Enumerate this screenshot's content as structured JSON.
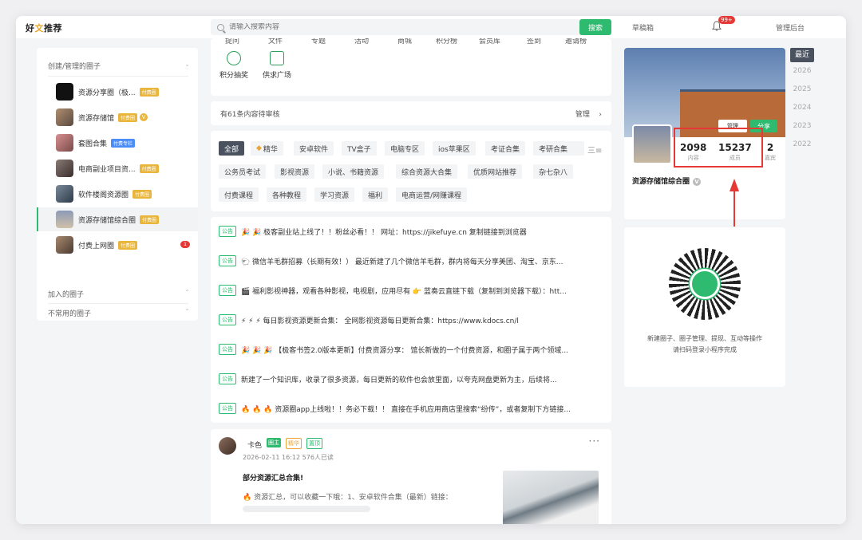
{
  "header": {
    "logo_main": "好",
    "logo_accent": "文",
    "logo_rest": "推荐",
    "search_placeholder": "请输入搜索内容",
    "search_button": "搜索",
    "drafts": "草稿箱",
    "notification_count": "99+",
    "admin": "管理后台"
  },
  "sidebar": {
    "section_created": "创建/管理的圈子",
    "section_joined": "加入的圈子",
    "section_unused": "不常用的圈子",
    "items": [
      {
        "name": "资源分享圈（极...",
        "tag": "付费圈",
        "tag_type": "paid",
        "thumb": "#111111"
      },
      {
        "name": "资源存储馆",
        "tag": "付费圈",
        "tag_type": "paid",
        "thumb": "#8e7a68",
        "verified": "V"
      },
      {
        "name": "套图合集",
        "tag": "付费专栏",
        "tag_type": "blue",
        "thumb": "#c47a7a"
      },
      {
        "name": "电商副业项目资...",
        "tag": "付费圈",
        "tag_type": "paid",
        "thumb": "#6a5a58"
      },
      {
        "name": "软件楼阁资源圈",
        "tag": "付费圈",
        "tag_type": "paid",
        "thumb": "#556677"
      },
      {
        "name": "资源存储馆综合圈",
        "tag": "付费圈",
        "tag_type": "paid",
        "thumb": "#9aa3b8",
        "active": true
      },
      {
        "name": "付费上网圈",
        "tag": "付费圈",
        "tag_type": "paid",
        "thumb": "#8a7060",
        "count": "1"
      }
    ]
  },
  "nav": {
    "top_row": [
      "提问",
      "文件",
      "专题",
      "活动",
      "商城",
      "积分榜",
      "会员库",
      "签到",
      "邀请榜"
    ],
    "icons": [
      {
        "label": "积分抽奖"
      },
      {
        "label": "供求广场"
      }
    ]
  },
  "review": {
    "text": "有61条内容待审核",
    "manage": "管理",
    "chevron": "›"
  },
  "categories": {
    "row1": [
      "全部",
      "精华",
      "安卓软件",
      "TV盒子",
      "电脑专区",
      "ios苹果区",
      "考证合集",
      "考研合集"
    ],
    "row1_more": "三≡",
    "row2": [
      "公务员考试",
      "影视资源",
      "小说、书籍资源",
      "综合资源大合集",
      "优质网站推荐",
      "杂七杂八"
    ],
    "row3": [
      "付费课程",
      "各种教程",
      "学习资源",
      "福利",
      "电商运营/网赚课程"
    ]
  },
  "announcements": [
    {
      "tag": "公告",
      "text": "🎉 🎉 极客副业站上线了！！粉丝必看！！ 网址：https://jikefuye.cn 复制链接到浏览器"
    },
    {
      "tag": "公告",
      "text": "🐑 微信羊毛群招募（长期有效！） 最近新建了几个微信羊毛群，群内将每天分享美团、淘宝、京东..."
    },
    {
      "tag": "公告",
      "text": "🎬 福利影视神器，观看各种影视，电视剧，应用尽有 👉 蓝奏云直链下载（复制到浏览器下载）：htt..."
    },
    {
      "tag": "公告",
      "text": "⚡ ⚡ ⚡ 每日影视资源更新合集： 全网影视资源每日更新合集：https://www.kdocs.cn/l"
    },
    {
      "tag": "公告",
      "text": "🎉 🎉 🎉 【极客书签2.0版本更新】付费资源分享： 馆长新做的一个付费资源，和圈子属于两个领域..."
    },
    {
      "tag": "公告",
      "text": "新建了一个知识库，收录了很多资源，每日更新的软件也会放里面，以夸克网盘更新为主，后续将..."
    },
    {
      "tag": "公告",
      "text": "🔥 🔥 🔥 资源圈app上线啦！！务必下载！！ 直接在手机应用商店里搜索“纷传”，或者复制下方链接..."
    }
  ],
  "post": {
    "author": "卡色",
    "tags": [
      "圈主",
      "精华",
      "置顶"
    ],
    "meta": "2026-02-11 16:12   576人已读",
    "more": "···",
    "title": "部分资源汇总合集!",
    "body": "🔥 资源汇总，可以收藏一下哦：1、安卓软件合集（最新）链接："
  },
  "group": {
    "btn_manage": "管理",
    "btn_share": "分享",
    "stats": [
      {
        "value": "2098",
        "label": "内容"
      },
      {
        "value": "15237",
        "label": "成员"
      },
      {
        "value": "2",
        "label": "嘉宾"
      }
    ],
    "name": "资源存储馆综合圈",
    "verified": "V"
  },
  "years": [
    "最近",
    "2026",
    "2025",
    "2024",
    "2023",
    "2022"
  ],
  "qr": {
    "line1": "新建圈子、圈子管理、提现、互动等操作",
    "line2": "请扫码登录小程序完成"
  },
  "colors": {
    "brand_green": "#2ebb6f",
    "highlight_red": "#e53935",
    "paid_gold": "#e9b53a"
  }
}
